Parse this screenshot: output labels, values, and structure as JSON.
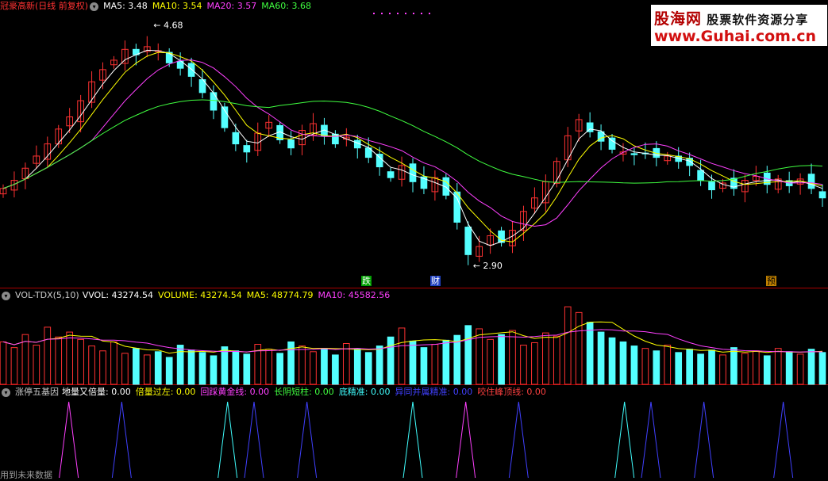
{
  "main": {
    "title": "冠豪高新(日线 前复权)",
    "ma_labels": [
      {
        "text": "MA5: 3.48",
        "color": "#ffffff"
      },
      {
        "text": "MA10: 3.54",
        "color": "#ffff00"
      },
      {
        "text": "MA20: 3.57",
        "color": "#ff40ff"
      },
      {
        "text": "MA60: 3.68",
        "color": "#40ff40"
      }
    ],
    "high_label": "4.68",
    "low_label": "2.90",
    "markers": [
      {
        "text": "跌",
        "bg": "#00a000",
        "color": "#ffffff"
      },
      {
        "text": "财",
        "bg": "#2040c0",
        "color": "#ffffff"
      },
      {
        "text": "预",
        "bg": "#c08000",
        "color": "#000000"
      }
    ]
  },
  "volume": {
    "title": "VOL-TDX(5,10)",
    "labels": [
      {
        "text": "VVOL: 43274.54",
        "color": "#ffffff"
      },
      {
        "text": "VOLUME: 43274.54",
        "color": "#ffff00"
      },
      {
        "text": "MA5: 48774.79",
        "color": "#ffff00"
      },
      {
        "text": "MA10: 45582.56",
        "color": "#ff40ff"
      }
    ]
  },
  "indicator": {
    "title": "涨停五基因",
    "labels": [
      {
        "text": "地量又倍量: 0.00",
        "color": "#ffffff"
      },
      {
        "text": "倍量过左: 0.00",
        "color": "#ffff00"
      },
      {
        "text": "回踩黄金线: 0.00",
        "color": "#ff40ff"
      },
      {
        "text": "长阴短柱: 0.00",
        "color": "#40ff40"
      },
      {
        "text": "底精准: 0.00",
        "color": "#40ffff"
      },
      {
        "text": "异同并属精准: 0.00",
        "color": "#4040ff"
      },
      {
        "text": "咬住峰顶线: 0.00",
        "color": "#ff4040"
      }
    ],
    "footer": "用到未来数据"
  },
  "logo": {
    "line1a": "股海网",
    "line1b": " 股票软件资源分享",
    "line2": "www.Guhai.com.cn"
  },
  "colors": {
    "up": "#ff3232",
    "down": "#54ffff",
    "ma5": "#ffffff",
    "ma10": "#ffff00",
    "ma20": "#ff40ff",
    "ma60": "#40ff40"
  },
  "chart_data": [
    {
      "type": "candlestick",
      "price_range": [
        2.9,
        4.68
      ],
      "close": [
        3.47,
        3.53,
        3.62,
        3.71,
        3.8,
        3.91,
        4.0,
        4.12,
        4.26,
        4.35,
        4.42,
        4.5,
        4.46,
        4.52,
        4.49,
        4.4,
        4.36,
        4.3,
        4.18,
        4.05,
        3.92,
        3.8,
        3.74,
        3.88,
        3.96,
        3.83,
        3.77,
        3.9,
        3.95,
        3.86,
        3.8,
        3.85,
        3.77,
        3.7,
        3.63,
        3.55,
        3.64,
        3.52,
        3.47,
        3.55,
        3.42,
        3.22,
        2.98,
        3.04,
        3.12,
        3.07,
        3.16,
        3.3,
        3.4,
        3.52,
        3.67,
        3.86,
        3.98,
        3.89,
        3.82,
        3.76,
        3.74,
        3.72,
        3.73,
        3.7,
        3.71,
        3.67,
        3.64,
        3.53,
        3.46,
        3.51,
        3.47,
        3.53,
        3.56,
        3.5,
        3.54,
        3.49,
        3.54,
        3.47,
        3.4
      ]
    },
    {
      "type": "bar",
      "series": [
        {
          "name": "VOLUME",
          "values": [
            52000,
            45000,
            61000,
            48000,
            70000,
            58000,
            64000,
            55000,
            47000,
            41000,
            52000,
            38000,
            44000,
            36000,
            40000,
            33000,
            48000,
            42000,
            39000,
            35000,
            46000,
            41000,
            37000,
            49000,
            43000,
            38000,
            52000,
            47000,
            40000,
            44000,
            36000,
            50000,
            43000,
            39000,
            47000,
            58000,
            69000,
            53000,
            45000,
            49000,
            54000,
            60000,
            72000,
            68000,
            55000,
            61000,
            66000,
            48000,
            51000,
            63000,
            59000,
            95000,
            88000,
            76000,
            64000,
            57000,
            52000,
            47000,
            44000,
            41000,
            48000,
            39000,
            43000,
            37000,
            42000,
            36000,
            45000,
            38000,
            41000,
            35000,
            44000,
            40000,
            37000,
            43000,
            39000
          ]
        }
      ]
    },
    {
      "type": "line",
      "series": [
        {
          "name": "涨停五基因",
          "values": [
            0,
            0,
            1,
            0,
            1,
            0,
            0,
            0,
            1,
            1,
            0,
            1,
            0,
            0,
            0,
            1,
            0,
            1,
            0,
            1,
            0,
            0,
            0,
            1,
            1,
            0,
            1,
            0,
            0,
            1,
            0
          ]
        }
      ]
    }
  ]
}
